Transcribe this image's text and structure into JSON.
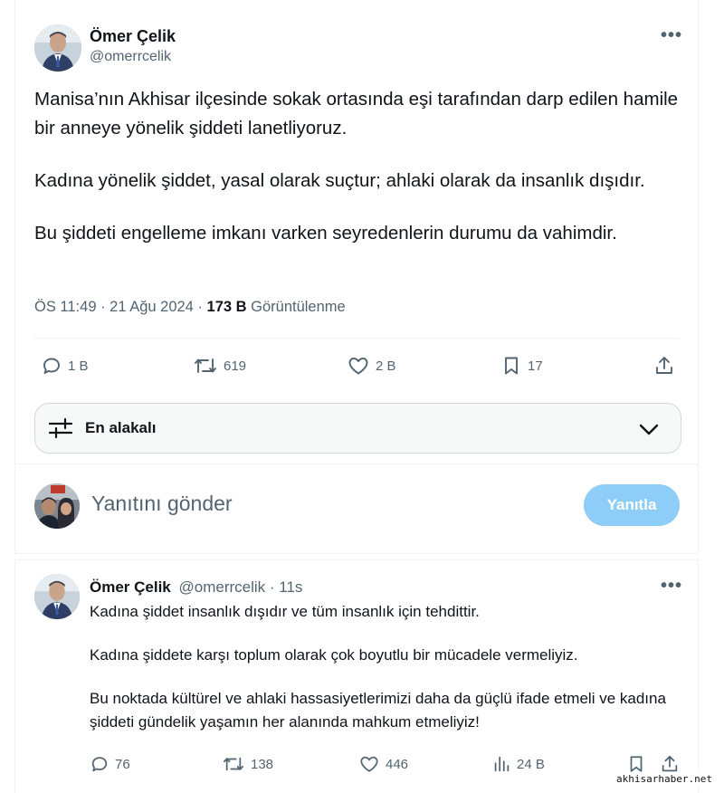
{
  "main_tweet": {
    "author_name": "Ömer Çelik",
    "author_handle": "@omerrcelik",
    "more_label": "•••",
    "paragraphs": [
      "Manisa’nın Akhisar ilçesinde sokak ortasında eşi tarafından darp edilen hamile bir anneye yönelik şiddeti lanetliyoruz.",
      "Kadına yönelik şiddet, yasal olarak suçtur; ahlaki olarak da insanlık dışıdır.",
      "Bu şiddeti engelleme imkanı varken seyredenlerin durumu da vahimdir."
    ],
    "time": "ÖS 11:49",
    "sep": " · ",
    "date": "21 Ağu 2024",
    "views_count": "173 B",
    "views_label": " Görüntülenme",
    "actions": {
      "replies": "1 B",
      "reposts": "619",
      "likes": "2 B",
      "bookmarks": "17"
    }
  },
  "sort": {
    "label": "En alakalı"
  },
  "compose": {
    "placeholder": "Yanıtını gönder",
    "button_label": "Yanıtla"
  },
  "reply_tweet": {
    "author_name": "Ömer Çelik",
    "author_handle": "@omerrcelik",
    "time": "11s",
    "sep": " · ",
    "more_label": "•••",
    "paragraphs": [
      "Kadına şiddet insanlık dışıdır ve tüm insanlık için tehdittir.",
      "Kadına şiddete karşı toplum olarak çok boyutlu bir mücadele vermeliyiz.",
      "Bu noktada kültürel ve ahlaki hassasiyetlerimizi daha da güçlü ifade etmeli ve kadına şiddeti gündelik yaşamın her alanında mahkum etmeliyiz!"
    ],
    "actions": {
      "replies": "76",
      "reposts": "138",
      "likes": "446",
      "views": "24 B"
    }
  },
  "watermark": "akhisarhaber.net",
  "colors": {
    "accent_disabled": "#8ecdf8",
    "text_primary": "#0f1419",
    "text_secondary": "#536471",
    "border": "#eff3f4"
  },
  "icons": [
    "more-icon",
    "reply-icon",
    "repost-icon",
    "like-icon",
    "bookmark-icon",
    "share-icon",
    "sort-sliders-icon",
    "chevron-down-icon",
    "views-icon"
  ]
}
